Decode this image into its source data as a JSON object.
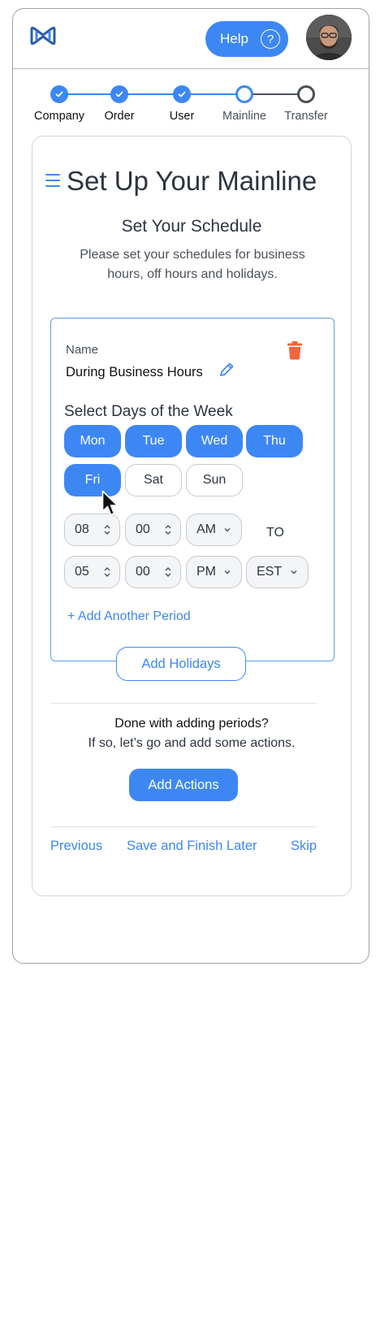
{
  "header": {
    "help_label": "Help",
    "help_icon": "?",
    "logo_icon": "bowtie-logo-icon",
    "avatar_icon": "user-avatar"
  },
  "stepper": {
    "steps": [
      {
        "label": "Company",
        "state": "done"
      },
      {
        "label": "Order",
        "state": "done"
      },
      {
        "label": "User",
        "state": "done"
      },
      {
        "label": "Mainline",
        "state": "current"
      },
      {
        "label": "Transfer",
        "state": "todo"
      }
    ]
  },
  "page": {
    "title": "Set Up Your Mainline",
    "section_title": "Set Your Schedule",
    "section_desc": "Please set your schedules for business hours, off hours and holidays."
  },
  "period": {
    "name_label": "Name",
    "name_value": "During Business Hours",
    "days_title": "Select Days of the Week",
    "days": [
      {
        "label": "Mon",
        "selected": true
      },
      {
        "label": "Tue",
        "selected": true
      },
      {
        "label": "Wed",
        "selected": true
      },
      {
        "label": "Thu",
        "selected": true
      },
      {
        "label": "Fri",
        "selected": true
      },
      {
        "label": "Sat",
        "selected": false
      },
      {
        "label": "Sun",
        "selected": false
      }
    ],
    "start": {
      "hour": "08",
      "minute": "00",
      "ampm": "AM"
    },
    "to_label": "TO",
    "end": {
      "hour": "05",
      "minute": "00",
      "ampm": "PM"
    },
    "timezone": "EST",
    "add_period_label": "+ Add Another Period"
  },
  "actions": {
    "add_holidays": "Add Holidays",
    "done_question": "Done with adding periods?",
    "done_sub": "If so, let’s go and add some actions.",
    "add_actions": "Add Actions"
  },
  "footer_nav": {
    "previous": "Previous",
    "save_later": "Save and Finish Later",
    "skip": "Skip"
  },
  "colors": {
    "accent": "#3d87f5",
    "danger": "#f2643c",
    "text": "#2b3440"
  }
}
